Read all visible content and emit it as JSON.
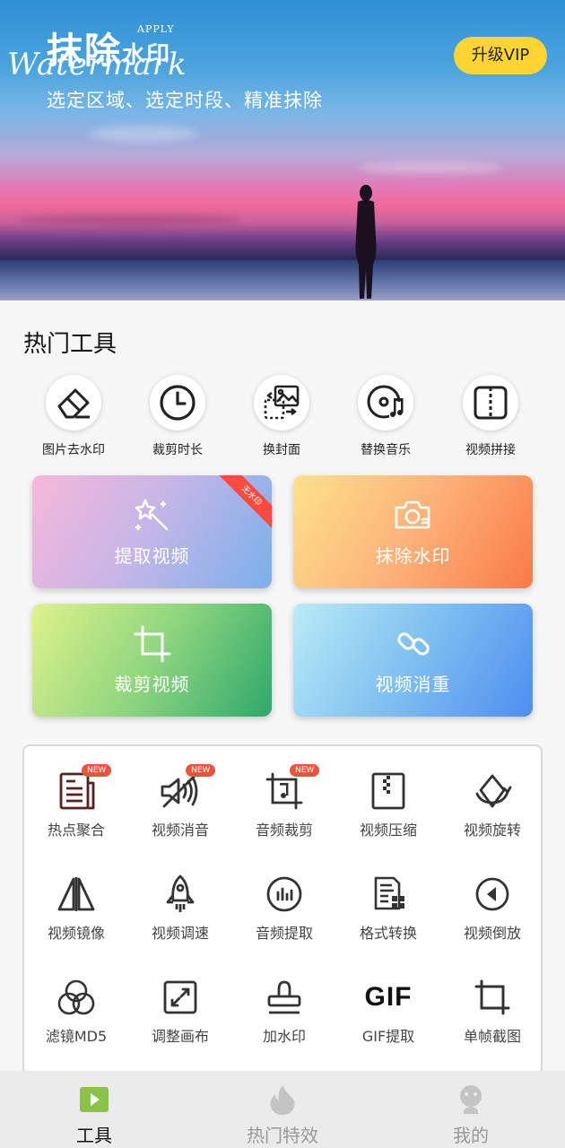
{
  "banner": {
    "title_big": "抹除",
    "title_small": "水印",
    "apply": "APPLY",
    "english": "Watermark",
    "subtitle": "选定区域、选定时段、精准抹除",
    "vip_label": "升级VIP"
  },
  "hot_tools": {
    "title": "热门工具",
    "items": [
      {
        "label": "图片去水印",
        "icon": "eraser-icon"
      },
      {
        "label": "裁剪时长",
        "icon": "clock-icon"
      },
      {
        "label": "换封面",
        "icon": "image-swap-icon"
      },
      {
        "label": "替换音乐",
        "icon": "music-disc-icon"
      },
      {
        "label": "视频拼接",
        "icon": "split-panel-icon"
      }
    ]
  },
  "feature_cards": [
    {
      "label": "提取视频",
      "icon": "magic-wand-icon",
      "ribbon": "无水印"
    },
    {
      "label": "抹除水印",
      "icon": "camera-icon"
    },
    {
      "label": "裁剪视频",
      "icon": "crop-icon"
    },
    {
      "label": "视频消重",
      "icon": "link-icon"
    }
  ],
  "tool_grid": [
    {
      "label": "热点聚合",
      "icon": "news-icon",
      "badge": "NEW"
    },
    {
      "label": "视频消音",
      "icon": "mute-icon",
      "badge": "NEW"
    },
    {
      "label": "音频裁剪",
      "icon": "audio-crop-icon",
      "badge": "NEW"
    },
    {
      "label": "视频压缩",
      "icon": "zip-icon"
    },
    {
      "label": "视频旋转",
      "icon": "rotate-icon"
    },
    {
      "label": "视频镜像",
      "icon": "mirror-icon"
    },
    {
      "label": "视频调速",
      "icon": "rocket-icon"
    },
    {
      "label": "音频提取",
      "icon": "audio-bars-icon"
    },
    {
      "label": "格式转换",
      "icon": "format-icon"
    },
    {
      "label": "视频倒放",
      "icon": "reverse-icon"
    },
    {
      "label": "滤镜MD5",
      "icon": "filter-icon"
    },
    {
      "label": "调整画布",
      "icon": "canvas-icon"
    },
    {
      "label": "加水印",
      "icon": "stamp-icon"
    },
    {
      "label": "GIF提取",
      "icon": "gif-icon",
      "icon_text": "GIF"
    },
    {
      "label": "单帧截图",
      "icon": "frame-crop-icon"
    }
  ],
  "nav": {
    "items": [
      {
        "label": "工具",
        "active": true,
        "icon": "play-icon"
      },
      {
        "label": "热门特效",
        "active": false,
        "icon": "flame-icon"
      },
      {
        "label": "我的",
        "active": false,
        "icon": "user-icon"
      }
    ]
  },
  "colors": {
    "vip": "#ffd531",
    "badge": "#f2513d",
    "nav_active_icon": "#8bc34a"
  }
}
